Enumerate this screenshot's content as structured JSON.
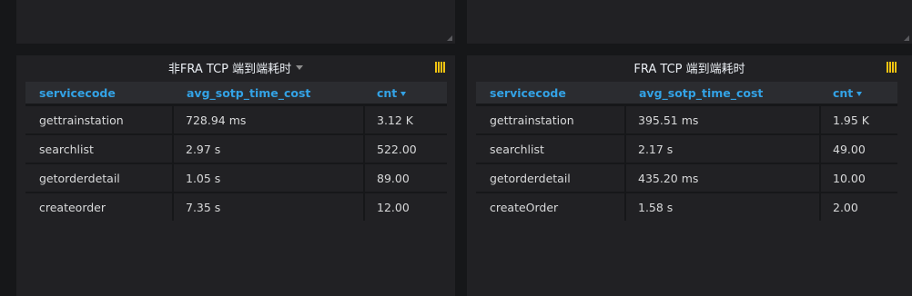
{
  "panels": [
    {
      "title": "非FRA TCP 端到端耗时",
      "columns": {
        "servicecode": "servicecode",
        "avg": "avg_sotp_time_cost",
        "cnt": "cnt"
      },
      "rows": [
        {
          "servicecode": "gettrainstation",
          "avg": "728.94 ms",
          "cnt": "3.12 K"
        },
        {
          "servicecode": "searchlist",
          "avg": "2.97 s",
          "cnt": "522.00"
        },
        {
          "servicecode": "getorderdetail",
          "avg": "1.05 s",
          "cnt": "89.00"
        },
        {
          "servicecode": "createorder",
          "avg": "7.35 s",
          "cnt": "12.00"
        }
      ]
    },
    {
      "title": "FRA TCP 端到端耗时",
      "columns": {
        "servicecode": "servicecode",
        "avg": "avg_sotp_time_cost",
        "cnt": "cnt"
      },
      "rows": [
        {
          "servicecode": "gettrainstation",
          "avg": "395.51 ms",
          "cnt": "1.95 K"
        },
        {
          "servicecode": "searchlist",
          "avg": "2.17 s",
          "cnt": "49.00"
        },
        {
          "servicecode": "getorderdetail",
          "avg": "435.20 ms",
          "cnt": "10.00"
        },
        {
          "servicecode": "createOrder",
          "avg": "1.58 s",
          "cnt": "2.00"
        }
      ]
    }
  ],
  "colors": {
    "background": "#161719",
    "panel": "#212124",
    "header_text": "#33a2e5",
    "warning": "#f2c311"
  },
  "icons": {
    "title_dropdown": "caret-down-icon",
    "sort": "sort-desc-icon",
    "panel_status": "warning-bars-icon",
    "resize": "resize-handle-icon"
  }
}
